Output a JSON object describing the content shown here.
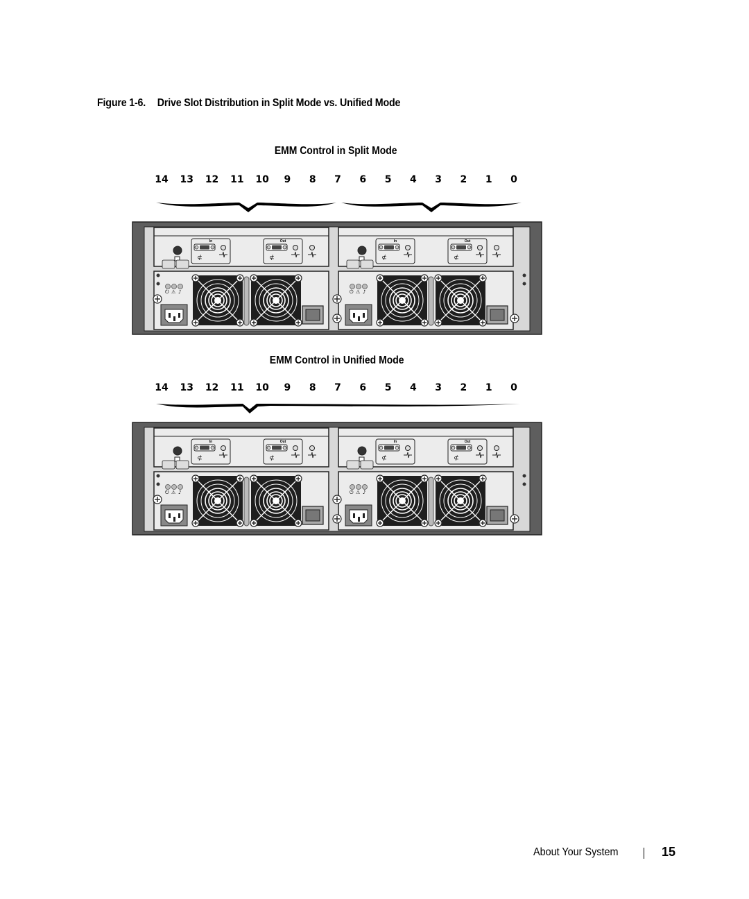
{
  "caption": {
    "figure_number": "Figure 1-6.",
    "title": "Drive Slot Distribution in Split Mode vs. Unified Mode"
  },
  "split_mode": {
    "title": "EMM Control in Split Mode",
    "slots": [
      "14",
      "13",
      "12",
      "11",
      "10",
      "9",
      "8",
      "7",
      "6",
      "5",
      "4",
      "3",
      "2",
      "1",
      "0"
    ],
    "groups": [
      {
        "from": "14",
        "to": "7"
      },
      {
        "from": "6",
        "to": "0"
      }
    ]
  },
  "unified_mode": {
    "title": "EMM Control in Unified Mode",
    "slots": [
      "14",
      "13",
      "12",
      "11",
      "10",
      "9",
      "8",
      "7",
      "6",
      "5",
      "4",
      "3",
      "2",
      "1",
      "0"
    ],
    "groups": [
      {
        "from": "14",
        "to": "0"
      }
    ]
  },
  "chassis": {
    "emm_labels": {
      "in": "In",
      "out": "Out"
    },
    "modules": [
      "left",
      "right"
    ],
    "colors": {
      "frame": "#5e5e5e",
      "panel": "#ececec",
      "fan": "#1e1e1e",
      "outline": "#222222"
    }
  },
  "footer": {
    "section": "About Your System",
    "page_number": "15"
  }
}
